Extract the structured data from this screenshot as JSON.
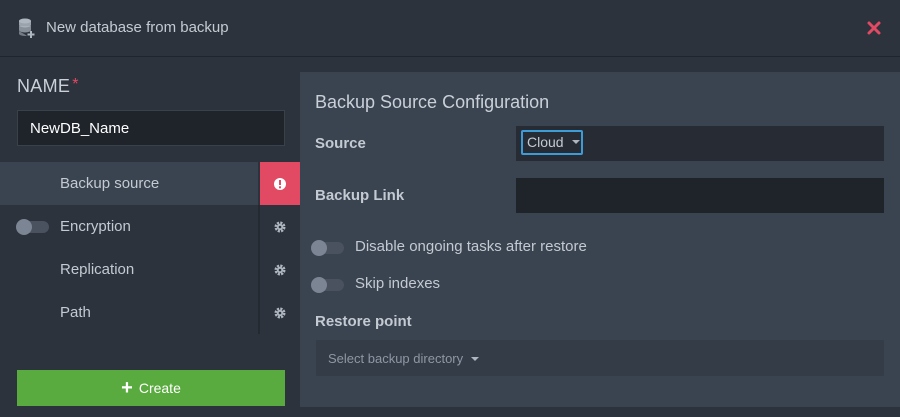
{
  "header": {
    "title": "New database from backup",
    "icon": "database-plus-icon",
    "close_icon": "close-icon",
    "close_color": "#e24a63"
  },
  "left": {
    "name_label": "NAME",
    "required_marker": "*",
    "name_value": "NewDB_Name",
    "steps": [
      {
        "label": "Backup source",
        "status_icon": "exclamation-icon",
        "active": true,
        "toggle": false
      },
      {
        "label": "Encryption",
        "status_icon": "gear-icon",
        "active": false,
        "toggle": true
      },
      {
        "label": "Replication",
        "status_icon": "gear-icon",
        "active": false,
        "toggle": false
      },
      {
        "label": "Path",
        "status_icon": "gear-icon",
        "active": false,
        "toggle": false
      }
    ],
    "create_label": "Create",
    "create_color": "#5aab3f"
  },
  "panel": {
    "title": "Backup Source Configuration",
    "source_label": "Source",
    "source_value": "Cloud",
    "backup_link_label": "Backup Link",
    "backup_link_value": "",
    "disable_tasks_label": "Disable ongoing tasks after restore",
    "skip_indexes_label": "Skip indexes",
    "restore_point_label": "Restore point",
    "restore_placeholder": "Select backup directory"
  }
}
